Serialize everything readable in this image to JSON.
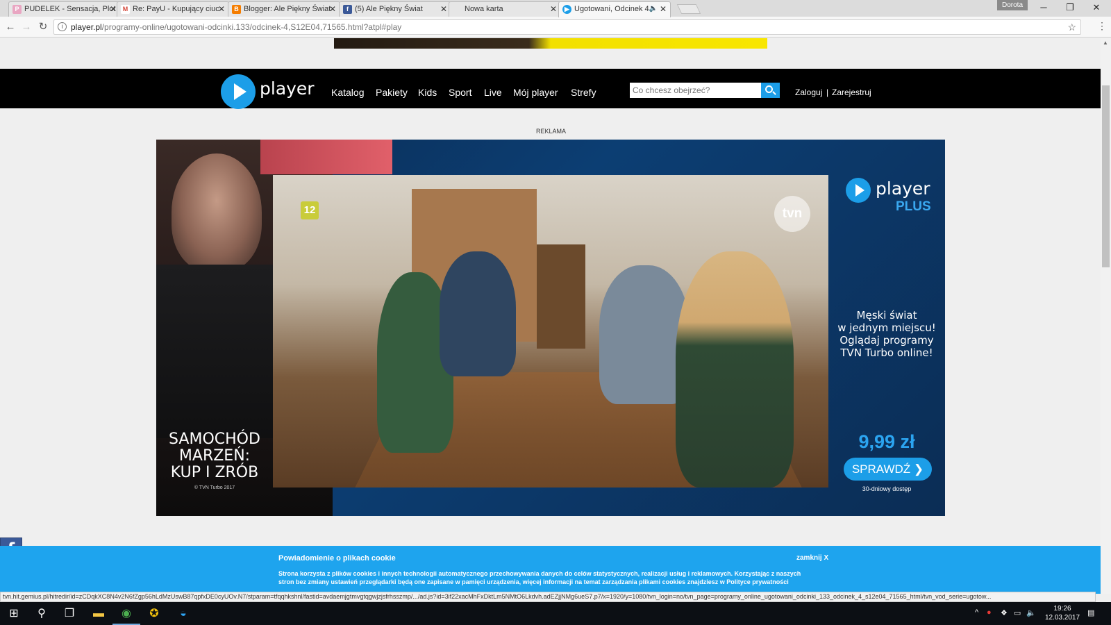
{
  "browser": {
    "tabs": [
      {
        "title": "PUDELEK - Sensacja, Plot",
        "favicon": "pudelek-icon",
        "color": "#e9a6c2"
      },
      {
        "title": "Re: PayU - Kupujący ciuc",
        "favicon": "gmail-icon",
        "color": "#d44638"
      },
      {
        "title": "Blogger: Ale Piękny Świat",
        "favicon": "blogger-icon",
        "color": "#f57d00"
      },
      {
        "title": "(5) Ale Piękny Świat",
        "favicon": "facebook-icon",
        "color": "#3b5998"
      },
      {
        "title": "Nowa karta",
        "favicon": "",
        "color": "#ffffff"
      },
      {
        "title": "Ugotowani, Odcinek 4",
        "favicon": "player-icon",
        "color": "#1c9ee8",
        "active": true,
        "audio": true
      }
    ],
    "user_badge": "Dorota",
    "address": {
      "host": "player.pl",
      "path": "/programy-online/ugotowani-odcinki.133/odcinek-4,S12E04,71565.html?atpl#play"
    },
    "status_url": "tvn.hit.gemius.pl/hitredir/id=zCDqkXC8N4v2N6fZgp56hLdMzUswB87qpfxDE0cyUOv.N7/stparam=tfqqhkshnl/fastid=avdaemjgtmvgtqgwjzjsfrhsszmp/.../ad.js?id=3if22xacMhFxDktLm5NMtO6Lkdvh.adEZjjNMg6ueS7.p7/x=1920/y=1080/tvn_login=no/tvn_page=programy_online_ugotowani_odcinki_133_odcinek_4_s12e04_71565_html/tvn_vod_serie=ugotow..."
  },
  "site": {
    "logo": "player",
    "nav": [
      "Katalog",
      "Pakiety",
      "Kids",
      "Sport",
      "Live",
      "Mój player",
      "Strefy"
    ],
    "search_placeholder": "Co chcesz obejrzeć?",
    "login": "Zaloguj",
    "separator": "|",
    "register": "Zarejestruj",
    "ad_label": "REKLAMA"
  },
  "ad": {
    "show_title": [
      "SAMOCHÓD",
      "MARZEŃ:",
      "KUP I ZRÓB"
    ],
    "copyright": "© TVN Turbo 2017",
    "rating": "12",
    "channel": "tvn",
    "brand": "player",
    "brand_suffix": "PLUS",
    "promo": [
      "Męski świat",
      "w jednym miejscu!",
      "Oglądaj programy",
      "TVN Turbo online!"
    ],
    "price": "9,99 zł",
    "cta": "SPRAWDŹ",
    "cta_note": "30-dniowy dostęp"
  },
  "cookie": {
    "title": "Powiadomienie o plikach cookie",
    "text": "Strona korzysta z plików cookies i innych technologii automatycznego przechowywania danych do celów statystycznych, realizacji usług i reklamowych. Korzystając z naszych stron bez zmiany ustawień przeglądarki będą one zapisane w pamięci urządzenia, więcej informacji na temat zarządzania plikami cookies znajdziesz w Polityce prywatności",
    "close": "zamknij X"
  },
  "taskbar": {
    "time": "19:26",
    "date": "12.03.2017"
  }
}
